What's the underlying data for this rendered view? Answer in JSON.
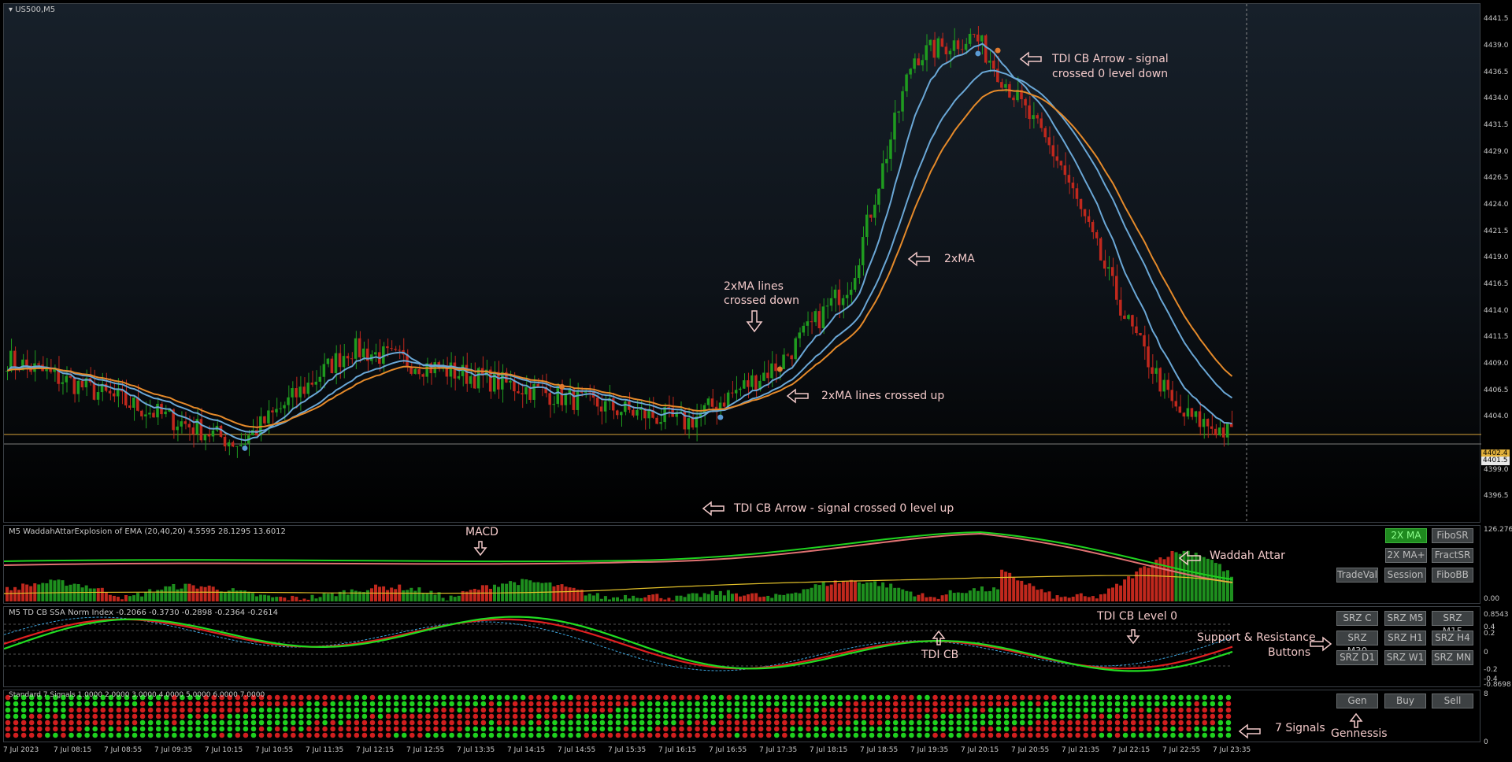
{
  "main": {
    "title": "US500,M5",
    "price_labels": [
      "4441.5",
      "4439.0",
      "4436.5",
      "4434.0",
      "4431.5",
      "4429.0",
      "4426.5",
      "4424.0",
      "4421.5",
      "4419.0",
      "4416.5",
      "4414.0",
      "4411.5",
      "4409.0",
      "4406.5",
      "4404.0",
      "4399.0",
      "4396.5"
    ],
    "current_bid": "4402.4",
    "current_ask": "4401.5",
    "colors": {
      "bull": "#1f9b1f",
      "bear": "#c0281d",
      "ma_fast": "#6aa7d6",
      "ma_slow": "#e58a2a",
      "annot": "#f2c9c9"
    },
    "annotations": {
      "tdi_down_1": "TDI CB Arrow - signal",
      "tdi_down_2": "crossed 0 level down",
      "ma_crossed_down_1": "2xMA lines",
      "ma_crossed_down_2": "crossed down",
      "two_ma": "2xMA",
      "ma_crossed_up": "2xMA lines crossed up",
      "tdi_up": "TDI CB Arrow - signal crossed 0 level up"
    }
  },
  "waddah": {
    "title": "M5  WaddahAttarExplosion of EMA (20,40,20) 4.5595 28.1295 13.6012",
    "axis_top": "126.2766",
    "axis_bottom": "0.00",
    "macd_label": "MACD",
    "waddah_label": "Waddah Attar"
  },
  "tdi": {
    "title": "M5  TD CB SSA Norm Index -0.2066 -0.3730 -0.2898 -0.2364 -0.2614",
    "axis": [
      "0.8543",
      "0.4",
      "0.2",
      "0",
      "-0.2",
      "-0.4",
      "-0.8698"
    ],
    "level0_label": "TDI CB Level 0",
    "tdi_cb_label": "TDI CB",
    "sr_label_1": "Support & Resistance",
    "sr_label_2": "Buttons"
  },
  "signals": {
    "title": "Standard 7 Signals 1.0000 2.0000 3.0000 4.0000 5.0000 6.0000 7.0000",
    "axis_top": "8",
    "axis_bottom": "0",
    "label": "7 Signals",
    "gen_label": "Gennessis"
  },
  "buttons": {
    "row1": [
      "2X MA",
      "FiboSR"
    ],
    "row2": [
      "2X MA+",
      "FractSR"
    ],
    "row3": [
      "TradeVal",
      "Session",
      "FiboBB"
    ],
    "srz1": [
      "SRZ C",
      "SRZ M5",
      "SRZ M15"
    ],
    "srz2": [
      "SRZ M30",
      "SRZ H1",
      "SRZ H4"
    ],
    "srz3": [
      "SRZ D1",
      "SRZ W1",
      "SRZ MN"
    ],
    "gen": [
      "Gen",
      "Buy",
      "Sell"
    ]
  },
  "time_labels": [
    "7 Jul 2023",
    "7 Jul 08:15",
    "7 Jul 08:55",
    "7 Jul 09:35",
    "7 Jul 10:15",
    "7 Jul 10:55",
    "7 Jul 11:35",
    "7 Jul 12:15",
    "7 Jul 12:55",
    "7 Jul 13:35",
    "7 Jul 14:15",
    "7 Jul 14:55",
    "7 Jul 15:35",
    "7 Jul 16:15",
    "7 Jul 16:55",
    "7 Jul 17:35",
    "7 Jul 18:15",
    "7 Jul 18:55",
    "7 Jul 19:35",
    "7 Jul 20:15",
    "7 Jul 20:55",
    "7 Jul 21:35",
    "7 Jul 22:15",
    "7 Jul 22:55",
    "7 Jul 23:35"
  ],
  "chart_data": {
    "type": "candlestick",
    "title": "US500,M5",
    "ylim": [
      4394,
      4443
    ],
    "key_points": [
      {
        "t": "7 Jul 2023",
        "close": 4409.5
      },
      {
        "t": "7 Jul 10:55",
        "close": 4401.5
      },
      {
        "t": "7 Jul 12:15",
        "close": 4410.5
      },
      {
        "t": "7 Jul 15:35",
        "close": 4405.0
      },
      {
        "t": "7 Jul 16:15",
        "close": 4403.5
      },
      {
        "t": "7 Jul 17:35",
        "close": 4409.0
      },
      {
        "t": "7 Jul 18:55",
        "close": 4417.0
      },
      {
        "t": "7 Jul 19:35",
        "close": 4438.0
      },
      {
        "t": "7 Jul 20:15",
        "close": 4440.0
      },
      {
        "t": "7 Jul 21:35",
        "close": 4428.0
      },
      {
        "t": "7 Jul 22:15",
        "close": 4413.0
      },
      {
        "t": "7 Jul 22:55",
        "close": 4404.5
      },
      {
        "t": "7 Jul 23:35",
        "close": 4402.4
      }
    ]
  }
}
